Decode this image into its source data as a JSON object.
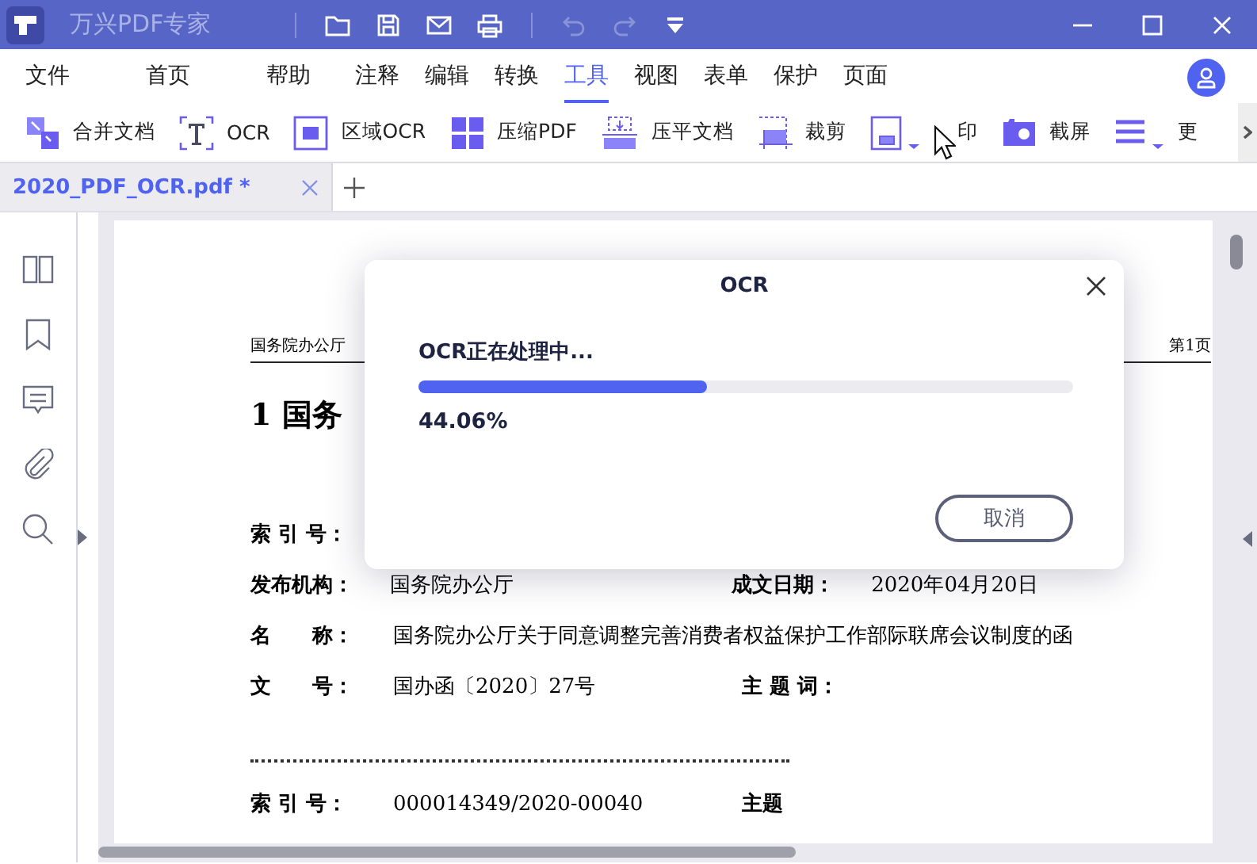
{
  "app": {
    "title": "万兴PDF专家"
  },
  "menu": [
    {
      "label": "文件",
      "selected": false
    },
    {
      "label": "首页",
      "selected": false
    },
    {
      "label": "帮助",
      "selected": false
    },
    {
      "label": "注释",
      "selected": false
    },
    {
      "label": "编辑",
      "selected": false
    },
    {
      "label": "转换",
      "selected": false
    },
    {
      "label": "工具",
      "selected": true
    },
    {
      "label": "视图",
      "selected": false
    },
    {
      "label": "表单",
      "selected": false
    },
    {
      "label": "保护",
      "selected": false
    },
    {
      "label": "页面",
      "selected": false
    }
  ],
  "toolbar": [
    {
      "kind": "merge",
      "label": "合并文档"
    },
    {
      "kind": "ocr",
      "label": "OCR"
    },
    {
      "kind": "area",
      "label": "区域OCR"
    },
    {
      "kind": "compress",
      "label": "压缩PDF"
    },
    {
      "kind": "flatten",
      "label": "压平文档"
    },
    {
      "kind": "crop",
      "label": "裁剪"
    },
    {
      "kind": "pagebox"
    },
    {
      "kind": "stamp",
      "label": "印"
    },
    {
      "kind": "capture",
      "label": "截屏"
    },
    {
      "kind": "more",
      "label": "更"
    }
  ],
  "tabs": [
    {
      "label": "2020_PDF_OCR.pdf *",
      "selected": true
    }
  ],
  "document": {
    "header_left": "国务院办公厅",
    "header_right": "第1页",
    "title": "1 国务",
    "rows": [
      {
        "label": "索 引 号："
      },
      {
        "label": "发布机构：",
        "value": "国务院办公厅",
        "label_2": "成文日期：",
        "value_2": "2020年04月20日"
      },
      {
        "label": "名　　称：",
        "value": "国务院办公厅关于同意调整完善消费者权益保护工作部际联席会议制度的函"
      },
      {
        "label": "文　　号：",
        "value": "国办函〔2020〕27号",
        "label_2": "主 题 词："
      },
      {
        "kind": "divider"
      },
      {
        "label": "索 引 号：",
        "value": "000014349/2020-00040",
        "label_2": "主题"
      }
    ]
  },
  "dialog": {
    "title": "OCR",
    "status": "OCR正在处理中...",
    "level": 0.4406,
    "percent": "44.06%",
    "button": "取消"
  }
}
